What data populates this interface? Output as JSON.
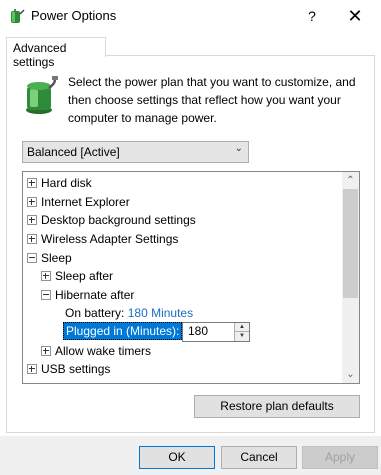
{
  "window": {
    "title": "Power Options",
    "help_label": "?",
    "close_label": "✕"
  },
  "tab": {
    "label": "Advanced settings"
  },
  "description": "Select the power plan that you want to customize, and then choose settings that reflect how you want your computer to manage power.",
  "plan_select": {
    "value": "Balanced [Active]"
  },
  "tree": {
    "items": [
      {
        "label": "Hard disk",
        "state": "collapsed"
      },
      {
        "label": "Internet Explorer",
        "state": "collapsed"
      },
      {
        "label": "Desktop background settings",
        "state": "collapsed"
      },
      {
        "label": "Wireless Adapter Settings",
        "state": "collapsed"
      },
      {
        "label": "Sleep",
        "state": "expanded"
      },
      {
        "label": "Sleep after",
        "state": "collapsed"
      },
      {
        "label": "Hibernate after",
        "state": "expanded"
      },
      {
        "label": "On battery:",
        "value": "180 Minutes"
      },
      {
        "label": "Plugged in (Minutes):",
        "value": "180"
      },
      {
        "label": "Allow wake timers",
        "state": "collapsed"
      },
      {
        "label": "USB settings",
        "state": "collapsed"
      }
    ]
  },
  "buttons": {
    "restore": "Restore plan defaults",
    "ok": "OK",
    "cancel": "Cancel",
    "apply": "Apply"
  },
  "colors": {
    "selection": "#0078d7",
    "link": "#1a6dc2"
  }
}
